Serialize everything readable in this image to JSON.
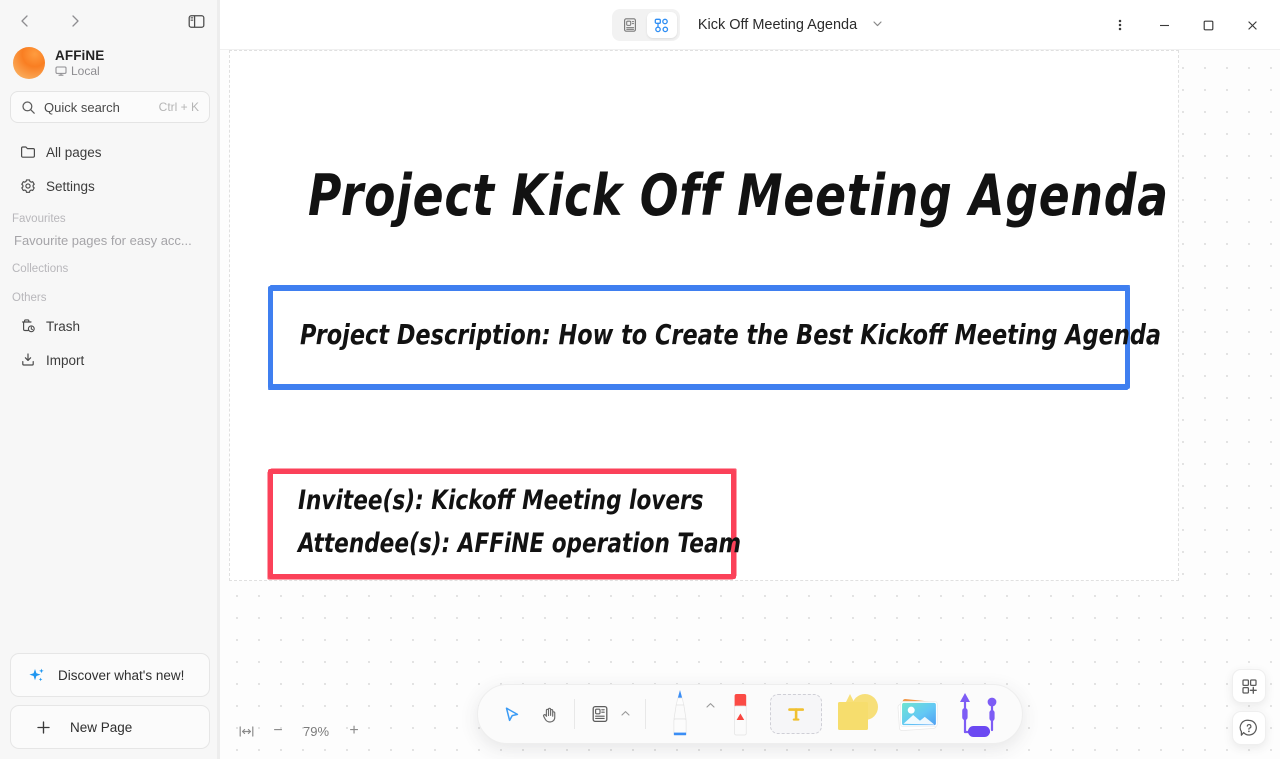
{
  "sidebar": {
    "nav": {
      "back": "‹",
      "forward": "›"
    },
    "panel_toggle_icon": "sidebar-panel-icon",
    "workspace": {
      "name": "AFFiNE",
      "sub_label": "Local",
      "sub_icon": "cloud-local-icon"
    },
    "search": {
      "label": "Quick search",
      "shortcut": "Ctrl + K",
      "icon": "search-icon"
    },
    "nav_items": [
      {
        "label": "All pages",
        "icon": "folder-icon"
      },
      {
        "label": "Settings",
        "icon": "gear-icon"
      }
    ],
    "sections": [
      {
        "title": "Favourites",
        "hint": "Favourite pages for easy acc..."
      },
      {
        "title": "Collections",
        "hint": ""
      },
      {
        "title": "Others",
        "hint": ""
      }
    ],
    "other_items": [
      {
        "label": "Trash",
        "icon": "trash-icon"
      },
      {
        "label": "Import",
        "icon": "import-icon"
      }
    ],
    "bottom_buttons": [
      {
        "label": "Discover what's new!",
        "icon": "sparkle-icon"
      },
      {
        "label": "New Page",
        "icon": "plus-icon"
      }
    ]
  },
  "titlebar": {
    "mode_page_icon": "page-mode-icon",
    "mode_edgeless_icon": "edgeless-mode-icon",
    "active_mode": "edgeless",
    "doc_title": "Kick Off Meeting Agenda",
    "title_chevron_icon": "chevron-down-icon",
    "more_icon": "more-vertical-icon",
    "minimize_icon": "minimize-icon",
    "maximize_icon": "maximize-icon",
    "close_icon": "close-icon"
  },
  "canvas": {
    "title_text": "Project Kick Off Meeting Agenda",
    "blue_box_text": "Project Description: How to Create the Best Kickoff Meeting Agenda",
    "red_box_line1": "Invitee(s): Kickoff Meeting lovers",
    "red_box_line2": "Attendee(s): AFFiNE operation Team",
    "colors": {
      "blue_border": "#3f7ff0",
      "red_border": "#fb4159",
      "text": "#121212"
    }
  },
  "zoom": {
    "fit_icon": "fit-to-screen-icon",
    "minus_label": "−",
    "value": "79%",
    "plus_label": "+"
  },
  "toolbar": {
    "select_icon": "select-arrow-icon",
    "hand_icon": "hand-pan-icon",
    "note_icon": "note-icon",
    "note_chevron_icon": "chevron-up-icon",
    "pen_icon": "pen-tool-icon",
    "pen_chevron_icon": "chevron-up-icon",
    "eraser_icon": "eraser-tool-icon",
    "text_icon": "text-tool-icon",
    "shape_icon": "shape-tool-icon",
    "image_icon": "image-tool-icon",
    "connector_icon": "connector-tool-icon",
    "active_tool": "text"
  },
  "right_float": {
    "template_icon": "template-grid-plus-icon",
    "help_icon": "help-question-icon"
  }
}
